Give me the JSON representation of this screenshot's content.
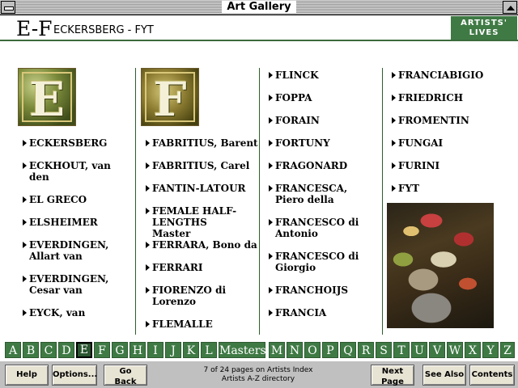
{
  "window": {
    "title": "Art Gallery"
  },
  "header": {
    "letter_range": "E-F",
    "range_names": "ECKERSBERG - FYT",
    "artists_lives": "ARTISTS' LIVES"
  },
  "initials": [
    "E",
    "F"
  ],
  "columns": [
    [
      "ECKERSBERG",
      "ECKHOUT, van den",
      "EL GRECO",
      "ELSHEIMER",
      "EVERDINGEN, Allart van",
      "EVERDINGEN, Cesar van",
      "EYCK, van"
    ],
    [
      "FABRITIUS, Barent",
      "FABRITIUS, Carel",
      "FANTIN-LATOUR",
      "FEMALE HALF-LENGTHS Master",
      "FERRARA, Bono da",
      "FERRARI",
      "FIORENZO di Lorenzo",
      "FLEMALLE"
    ],
    [
      "FLINCK",
      "FOPPA",
      "FORAIN",
      "FORTUNY",
      "FRAGONARD",
      "FRANCESCA, Piero della",
      "FRANCESCO di Antonio",
      "FRANCESCO di Giorgio",
      "FRANCHOIJS",
      "FRANCIA"
    ],
    [
      "FRANCIABIGIO",
      "FRIEDRICH",
      "FROMENTIN",
      "FUNGAI",
      "FURINI",
      "FYT"
    ]
  ],
  "alphabet": [
    "A",
    "B",
    "C",
    "D",
    "E",
    "F",
    "G",
    "H",
    "I",
    "J",
    "K",
    "L",
    "Masters",
    "M",
    "N",
    "O",
    "P",
    "Q",
    "R",
    "S",
    "T",
    "U",
    "V",
    "W",
    "X",
    "Y",
    "Z"
  ],
  "alphabet_selected": "E",
  "toolbar": {
    "help": "Help",
    "options": "Options...",
    "go_back_1": "Go",
    "go_back_2": "Back",
    "status_1": "7 of 24 pages on Artists Index",
    "status_2": "Artists A-Z directory",
    "next_1": "Next",
    "next_2": "Page",
    "see_also": "See Also",
    "contents": "Contents"
  },
  "colors": {
    "accent_green": "#3f7a45",
    "divider_green": "#2e5f2e",
    "toolbar_gray": "#c0c0c0"
  }
}
